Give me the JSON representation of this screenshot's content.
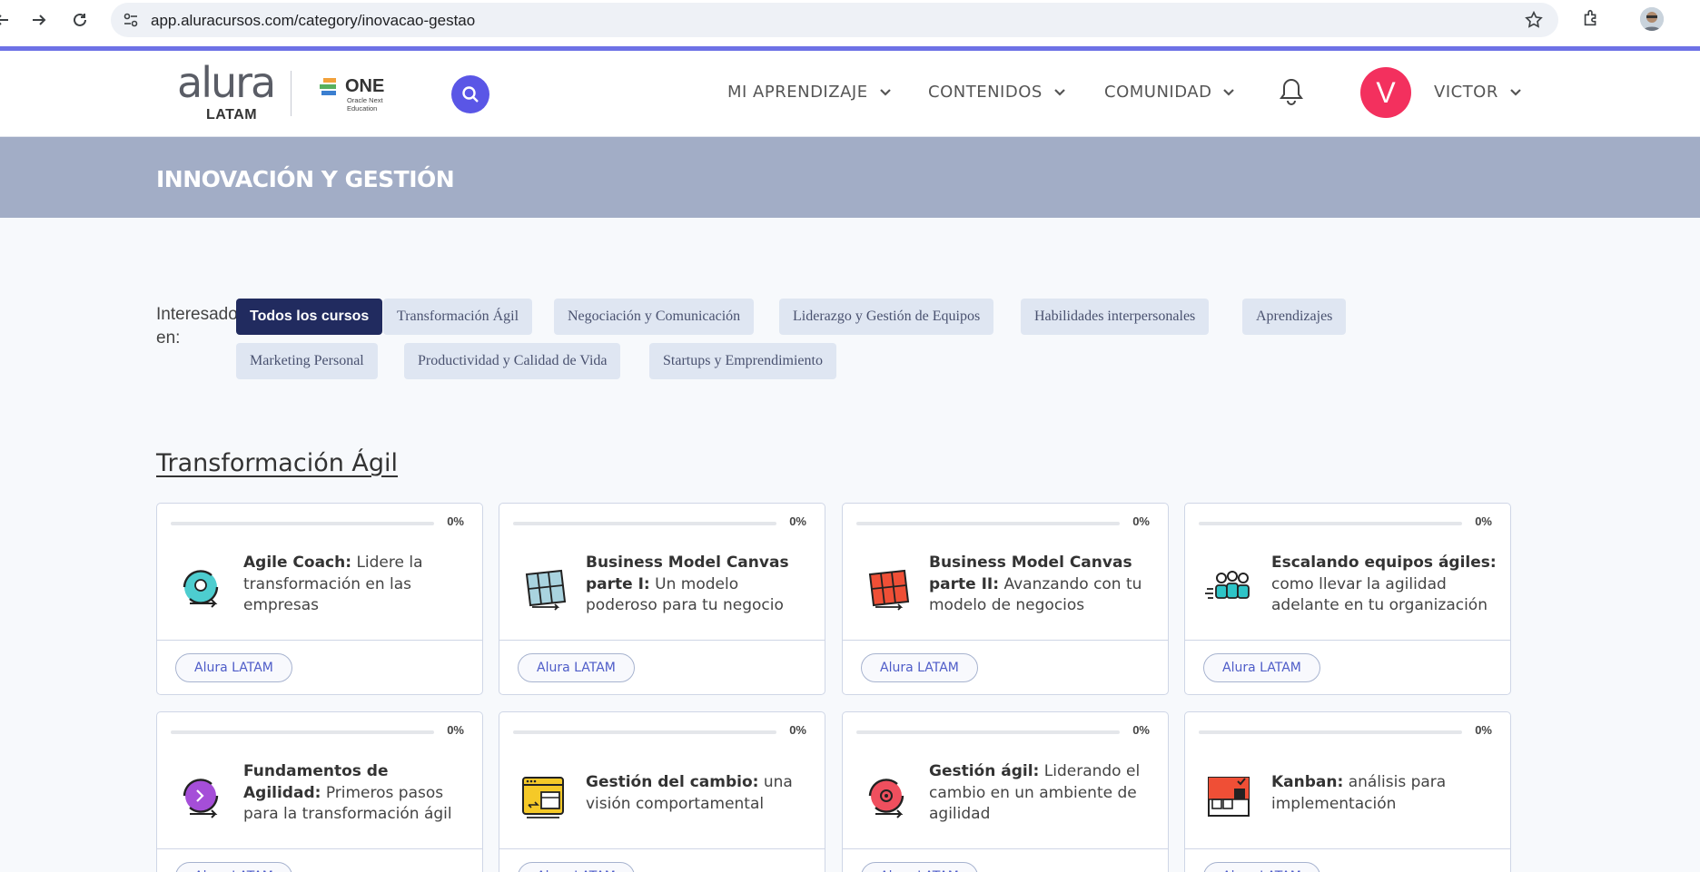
{
  "browser": {
    "url": "app.aluracursos.com/category/inovacao-gestao"
  },
  "header": {
    "logo_main": "alura",
    "logo_sub": "LATAM",
    "partner_logo": "ONE",
    "partner_sub": "Oracle Next Education",
    "menu": [
      {
        "label": "MI APRENDIZAJE"
      },
      {
        "label": "CONTENIDOS"
      },
      {
        "label": "COMUNIDAD"
      }
    ],
    "avatar_initial": "V",
    "user_name": "VICTOR",
    "colors": {
      "avatar": "#f3305e",
      "search": "#5a56e6"
    }
  },
  "banner": {
    "title": "INNOVACIÓN Y GESTIÓN"
  },
  "filters": {
    "label_line1": "Interesado",
    "label_line2": "en:",
    "chips": [
      {
        "label": "Todos los cursos",
        "active": true
      },
      {
        "label": "Transformación Ágil"
      },
      {
        "label": "Negociación y Comunicación"
      },
      {
        "label": "Liderazgo y Gestión de Equipos"
      },
      {
        "label": "Habilidades interpersonales"
      },
      {
        "label": "Aprendizajes"
      },
      {
        "label": "Marketing Personal"
      },
      {
        "label": "Productividad y Calidad de Vida"
      },
      {
        "label": "Startups y Emprendimiento"
      }
    ]
  },
  "section": {
    "title": "Transformación Ágil",
    "courses": [
      {
        "title_bold": "Agile Coach:",
        "title_rest": " Lidere la transformación en las empresas",
        "progress": "0%",
        "progress_value": 0,
        "school": "Alura LATAM",
        "icon": "agile-coach-icon"
      },
      {
        "title_bold": "Business Model Canvas parte I:",
        "title_rest": " Un modelo poderoso para tu negocio",
        "progress": "0%",
        "progress_value": 0,
        "school": "Alura LATAM",
        "icon": "canvas-blue-icon"
      },
      {
        "title_bold": "Business Model Canvas parte II:",
        "title_rest": " Avanzando con tu modelo de negocios",
        "progress": "0%",
        "progress_value": 0,
        "school": "Alura LATAM",
        "icon": "canvas-red-icon"
      },
      {
        "title_bold": "Escalando equipos ágiles:",
        "title_rest": " como llevar la agilidad adelante en tu organización",
        "progress": "0%",
        "progress_value": 0,
        "school": "Alura LATAM",
        "icon": "team-icon"
      },
      {
        "title_bold": "Fundamentos de Agilidad:",
        "title_rest": " Primeros pasos para la transformación ágil",
        "progress": "0%",
        "progress_value": 0,
        "school": "Alura LATAM",
        "icon": "agility-purple-icon"
      },
      {
        "title_bold": "Gestión del cambio:",
        "title_rest": " una visión comportamental",
        "progress": "0%",
        "progress_value": 0,
        "school": "Alura LATAM",
        "icon": "calendar-window-icon"
      },
      {
        "title_bold": "Gestión ágil:",
        "title_rest": " Liderando el cambio en un ambiente de agilidad",
        "progress": "0%",
        "progress_value": 0,
        "school": "Alura LATAM",
        "icon": "agile-red-icon"
      },
      {
        "title_bold": "Kanban:",
        "title_rest": " análisis para implementación",
        "progress": "0%",
        "progress_value": 0,
        "school": "Alura LATAM",
        "icon": "kanban-icon"
      }
    ]
  }
}
